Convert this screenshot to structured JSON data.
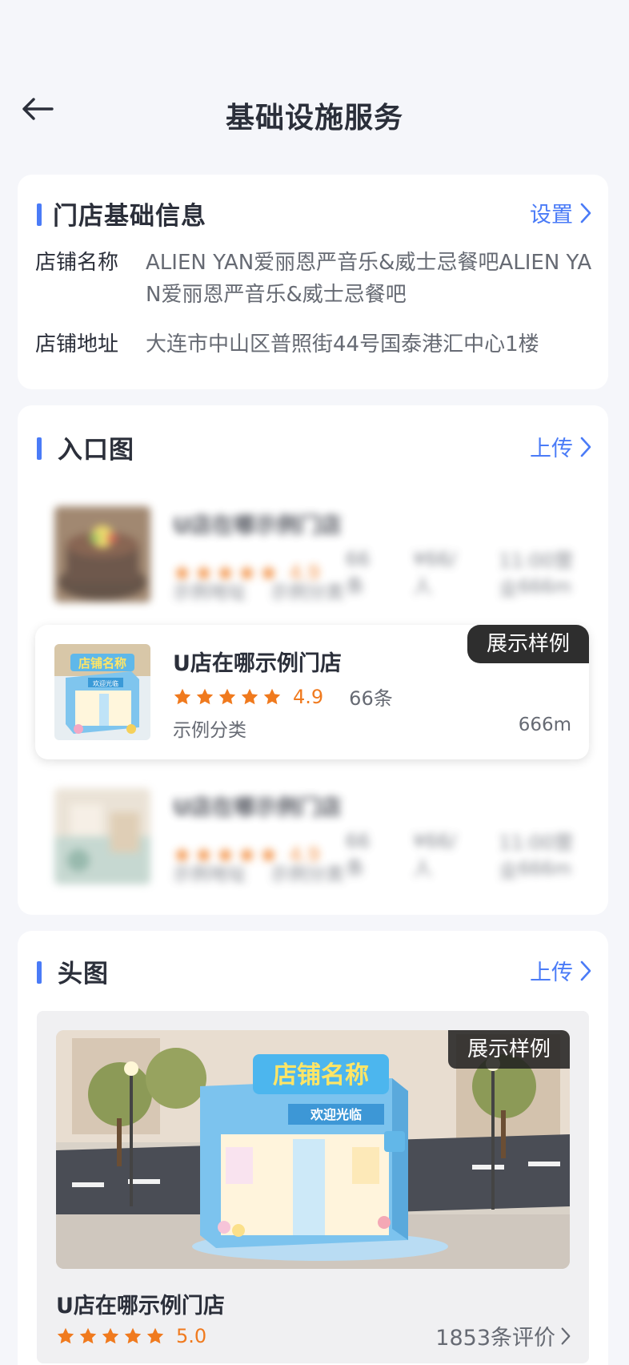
{
  "nav": {
    "title": "基础设施服务"
  },
  "store_info": {
    "title": "门店基础信息",
    "action": "设置",
    "name_label": "店铺名称",
    "name_value": "ALIEN YAN爱丽恩严音乐&威士忌餐吧ALIEN YAN爱丽恩严音乐&威士忌餐吧",
    "address_label": "店铺地址",
    "address_value": "大连市中山区普照街44号国泰港汇中心1楼"
  },
  "entrance": {
    "title": "入口图",
    "action": "上传",
    "sample_tag": "展示样例",
    "blur_rows": [
      {
        "name": "U店在哪示例门店",
        "rating": "4.9",
        "reviews": "66条",
        "price": "¥66/人",
        "hours": "11:00营业",
        "address": "示例地址",
        "category": "示例分类",
        "distance": "666m"
      },
      {
        "name": "U店在哪示例门店",
        "rating": "4.9",
        "reviews": "66条",
        "price": "¥66/人",
        "hours": "11:00营业",
        "address": "示例地址",
        "category": "示例分类",
        "distance": "666m"
      }
    ],
    "featured": {
      "name": "U店在哪示例门店",
      "rating": "4.9",
      "reviews": "66条",
      "category": "示例分类",
      "distance": "666m"
    }
  },
  "header_image": {
    "title": "头图",
    "action": "上传",
    "sample_tag": "展示样例",
    "store_sign": "店铺名称",
    "store_banner": "欢迎光临",
    "shop_name": "U店在哪示例门店",
    "rating": "5.0",
    "reviews": "1853条评价"
  },
  "colors": {
    "accent": "#4a7bf7",
    "star": "#f07a1e",
    "text": "#2b2f3a",
    "muted": "#666a73"
  },
  "icons": [
    "back-arrow-icon",
    "chevron-right-icon",
    "star-icon"
  ]
}
